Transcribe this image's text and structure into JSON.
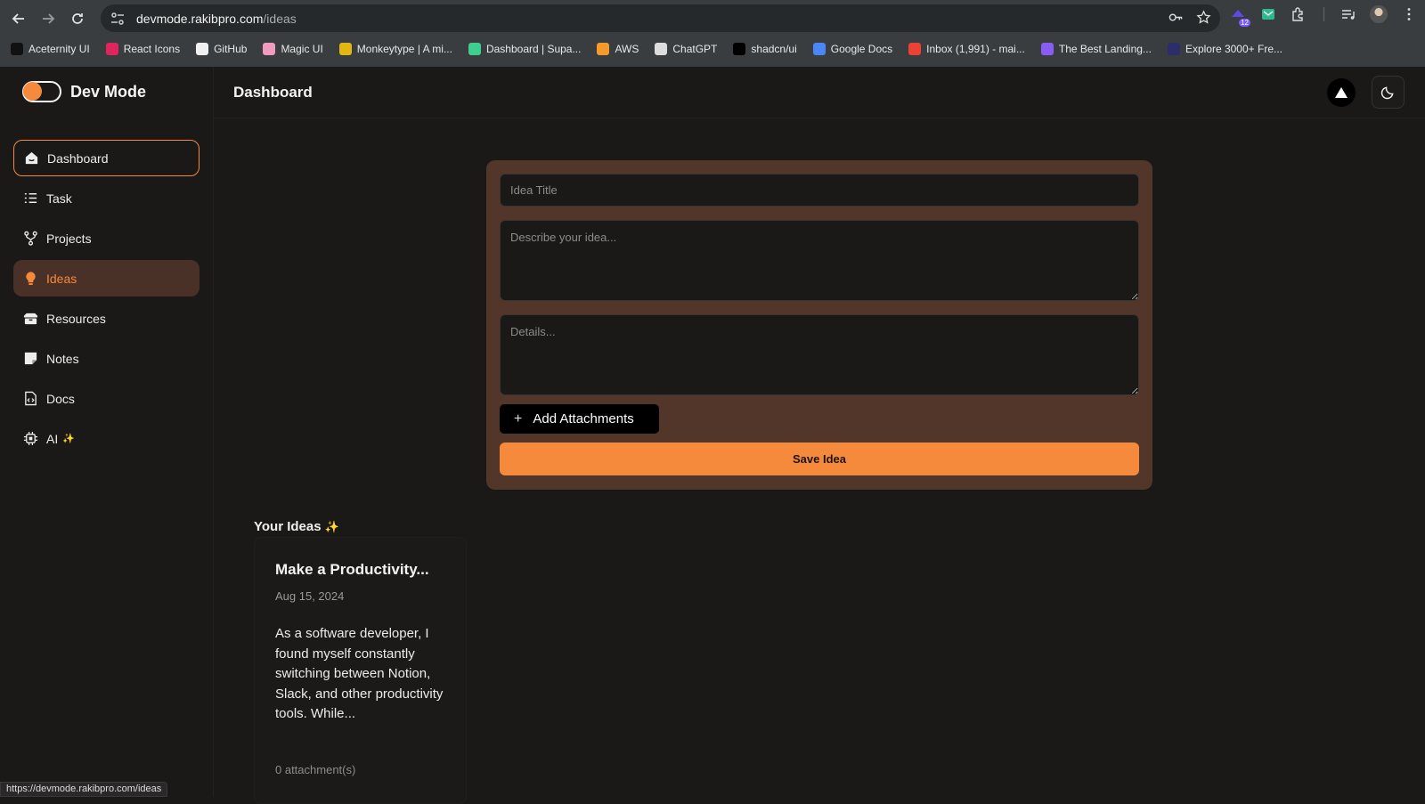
{
  "browser": {
    "url_host": "devmode.rakibpro.com",
    "url_path": "/ideas",
    "extension_badge": "12",
    "bookmarks": [
      {
        "label": "Aceternity UI",
        "color": "#111111"
      },
      {
        "label": "React Icons",
        "color": "#e0245e"
      },
      {
        "label": "GitHub",
        "color": "#f0f0f0"
      },
      {
        "label": "Magic UI",
        "color": "#f29bc1"
      },
      {
        "label": "Monkeytype | A mi...",
        "color": "#e2b714"
      },
      {
        "label": "Dashboard | Supa...",
        "color": "#3ecf8e"
      },
      {
        "label": "AWS",
        "color": "#f59b2b"
      },
      {
        "label": "ChatGPT",
        "color": "#dddddd"
      },
      {
        "label": "shadcn/ui",
        "color": "#000000"
      },
      {
        "label": "Google Docs",
        "color": "#4a86f7"
      },
      {
        "label": "Inbox (1,991) - mai...",
        "color": "#ea4335"
      },
      {
        "label": "The Best Landing...",
        "color": "#8a5cf6"
      },
      {
        "label": "Explore 3000+ Fre...",
        "color": "#2d2d6b"
      }
    ],
    "status_url": "https://devmode.rakibpro.com/ideas"
  },
  "sidebar": {
    "brand": "Dev Mode",
    "items": [
      {
        "label": "Dashboard",
        "icon": "home-icon",
        "state": "outlined"
      },
      {
        "label": "Task",
        "icon": "list-icon",
        "state": "normal"
      },
      {
        "label": "Projects",
        "icon": "git-fork-icon",
        "state": "normal"
      },
      {
        "label": "Ideas",
        "icon": "lightbulb-icon",
        "state": "active"
      },
      {
        "label": "Resources",
        "icon": "box-icon",
        "state": "normal"
      },
      {
        "label": "Notes",
        "icon": "sticky-note-icon",
        "state": "normal"
      },
      {
        "label": "Docs",
        "icon": "file-code-icon",
        "state": "normal"
      },
      {
        "label": "AI",
        "icon": "cpu-icon",
        "state": "normal",
        "suffix": "✨"
      }
    ]
  },
  "header": {
    "title": "Dashboard"
  },
  "form": {
    "title_placeholder": "Idea Title",
    "title_value": "",
    "description_placeholder": "Describe your idea...",
    "description_value": "",
    "details_placeholder": "Details...",
    "details_value": "",
    "attach_label": "Add Attachments",
    "save_label": "Save Idea"
  },
  "ideas": {
    "heading": "Your Ideas",
    "heading_emoji": "✨",
    "items": [
      {
        "title": "Make a Productivity...",
        "date": "Aug 15, 2024",
        "excerpt": "As a software developer, I found myself constantly switching between Notion, Slack, and other productivity tools. While...",
        "attachments": "0 attachment(s)"
      }
    ]
  },
  "colors": {
    "accent": "#f5893c",
    "active_bg": "#4a3128",
    "card_bg": "#53362a",
    "page_bg": "#1b1918"
  }
}
